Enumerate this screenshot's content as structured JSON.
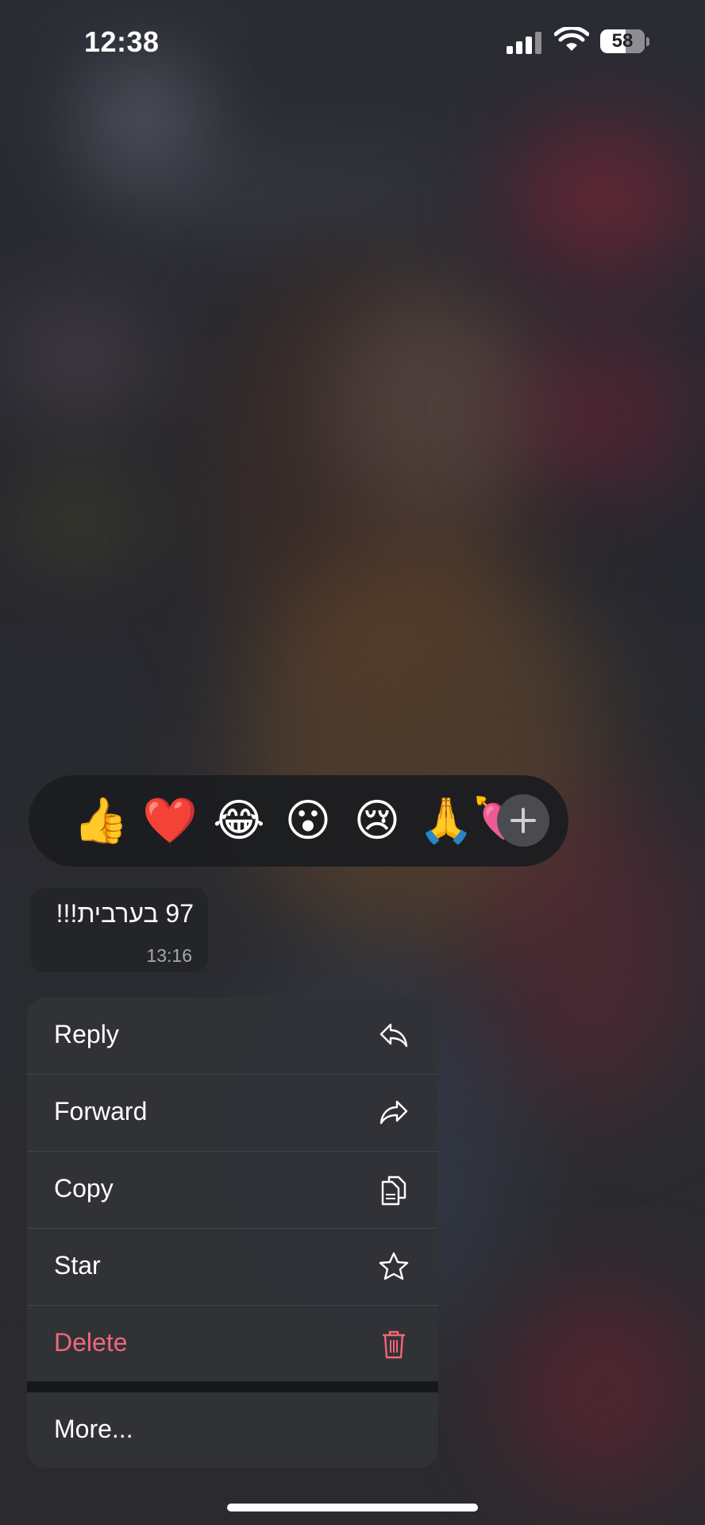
{
  "status_bar": {
    "time": "12:38",
    "battery": "58",
    "icons": [
      "cellular-signal-icon",
      "wifi-icon",
      "battery-icon"
    ]
  },
  "reactions": {
    "emojis": [
      "👍",
      "❤️",
      "😂",
      "😮",
      "😢",
      "🙏",
      "💘"
    ],
    "add_icon": "plus-icon"
  },
  "message": {
    "text": "97 בערבית!!!",
    "time": "13:16"
  },
  "menu": {
    "items": [
      {
        "label": "Reply",
        "icon": "reply-icon"
      },
      {
        "label": "Forward",
        "icon": "forward-icon"
      },
      {
        "label": "Copy",
        "icon": "copy-icon"
      },
      {
        "label": "Star",
        "icon": "star-icon"
      },
      {
        "label": "Delete",
        "icon": "trash-icon"
      }
    ],
    "more": "More..."
  },
  "colors": {
    "danger": "#f0677a",
    "menu_bg": "#323337",
    "reaction_bg": "#1c1d20"
  }
}
